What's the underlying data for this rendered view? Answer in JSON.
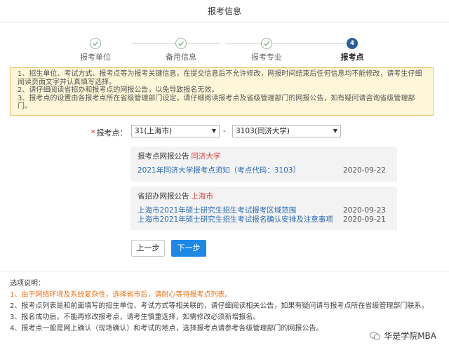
{
  "header": {
    "title": "报考信息"
  },
  "steps": [
    {
      "label": "报考单位",
      "state": "done"
    },
    {
      "label": "备用信息",
      "state": "done"
    },
    {
      "label": "报考专业",
      "state": "done"
    },
    {
      "label": "报考点",
      "state": "active",
      "number": "4"
    }
  ],
  "notice": {
    "lines": [
      "1、招生单位、考试方式、报考点等为报考关键信息，在提交信息后不允许修改，网报时间结束后任何信息均不能修改，请考生仔细阅读页面文字并认真填写选择。",
      "2、请仔细阅读省招办和报考点的网报公告，以免导致报名无效。",
      "3、报考点的设置由各报考点所在省级管理部门设定，请仔细阅读报考点及省级管理部门的网报公告，如有疑问请咨询省级管理部门。"
    ]
  },
  "form": {
    "required_mark": "*",
    "label": "报考点：",
    "province_select": "31(上海市)",
    "separator": "-",
    "site_select": "3103(同济大学)"
  },
  "site_panel": {
    "title": "报考点网报公告",
    "highlight": "同济大学",
    "items": [
      {
        "text": "2021年同济大学报考点须知（考点代码：3103）",
        "date": "2020-09-22"
      }
    ]
  },
  "province_panel": {
    "title": "省招办网报公告",
    "highlight": "上海市",
    "items": [
      {
        "text": "上海市2021年硕士研究生招生考试报考区域范围",
        "date": "2020-09-23"
      },
      {
        "text": "上海市2021年硕士研究生招生考试报名确认安排及注意事项",
        "date": "2020-09-21"
      }
    ]
  },
  "buttons": {
    "prev": "上一步",
    "next": "下一步"
  },
  "notes": {
    "title": "选项说明：",
    "items": [
      "1、由于网络环境及系统复杂性，选择省市后，请耐心等待报考点列表。",
      "2、报考点列表是和前面填写的招生单位、考试方式等相关联的，请仔细阅读相关公告，如果有疑问请与报考点所在省级管理部门联系。",
      "3、报名成功后，不能再修改报考点，请考生慎重选择，如需修改必须新增报名。",
      "4、报考点一般是网上确认（现场确认）和考试的地点，选择报考点请参考各级管理部门的网报公告。"
    ]
  },
  "watermark": {
    "text": "华是学院MBA"
  },
  "colors": {
    "accent": "#1e88e5",
    "active_step": "#2b5d9c",
    "warning": "#e8741a",
    "highlight": "#e03c3c",
    "link": "#2b6ab3"
  }
}
